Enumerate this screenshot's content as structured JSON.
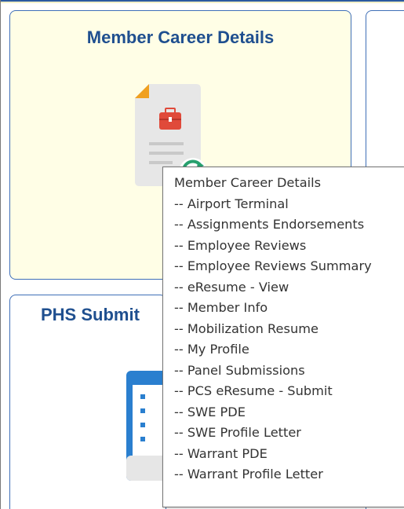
{
  "tiles": {
    "career": {
      "title": "Member Career Details",
      "icon": "career-document-icon"
    },
    "phs": {
      "title": "PHS Submit",
      "icon": "calendar-icon"
    }
  },
  "tooltip": {
    "heading": "Member Career Details",
    "items": [
      "-- Airport Terminal",
      "-- Assignments Endorsements",
      "-- Employee Reviews",
      "-- Employee Reviews Summary",
      "-- eResume - View",
      "-- Member Info",
      "-- Mobilization Resume",
      "-- My Profile",
      "-- Panel Submissions",
      "-- PCS eResume - Submit",
      "-- SWE PDE",
      "-- SWE Profile Letter",
      "-- Warrant PDE",
      "-- Warrant Profile Letter"
    ]
  },
  "colors": {
    "tile_border": "#3f6fb7",
    "tile_title": "#1f4f8f",
    "tile_highlight_bg": "#fffee6",
    "briefcase": "#e04a3a",
    "refresh": "#27a06e",
    "calendar": "#2a7fcf"
  }
}
